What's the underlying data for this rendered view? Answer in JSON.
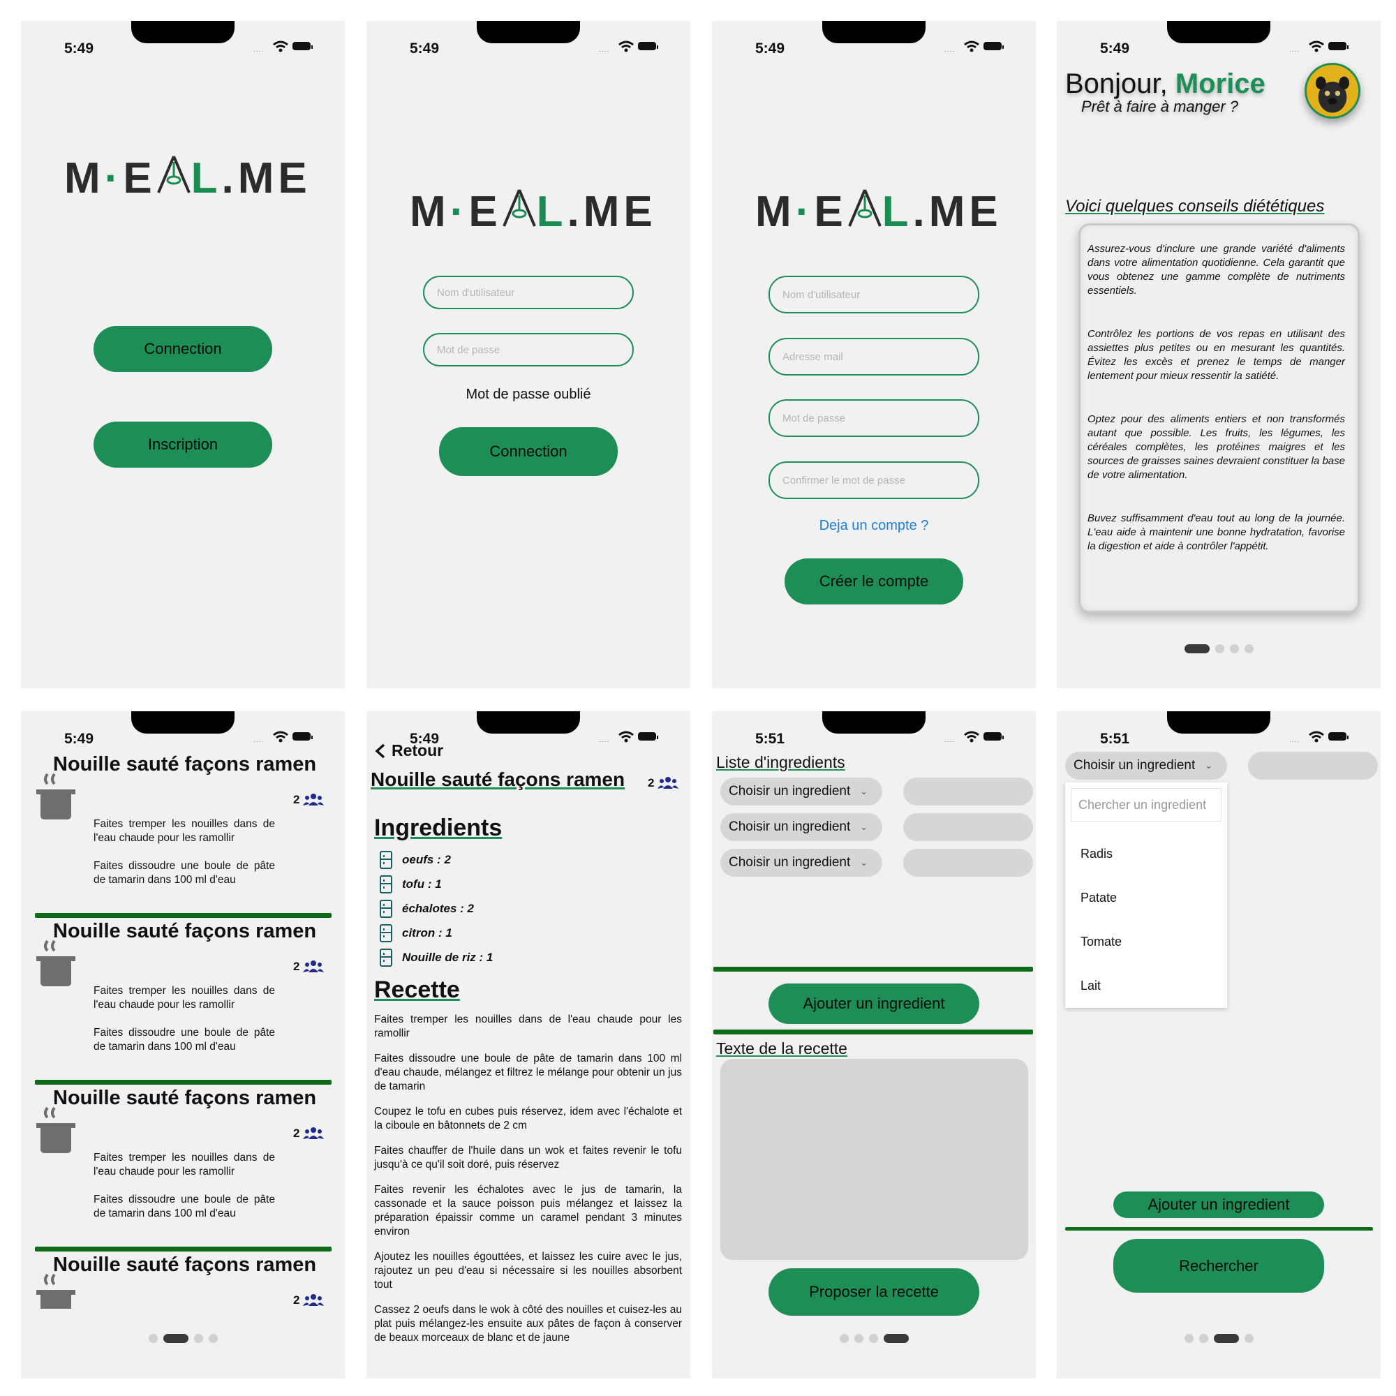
{
  "status": {
    "time_a": "5:49",
    "time_b": "5:51"
  },
  "logo": {
    "part1": "M",
    "part2": "E",
    "part3": "L",
    "part4": ".M",
    "part5": "E"
  },
  "screen1": {
    "connect": "Connection",
    "signup": "Inscription"
  },
  "screen2": {
    "username_ph": "Nom d'utilisateur",
    "password_ph": "Mot de passe",
    "forgot": "Mot de passe oublié",
    "connect": "Connection"
  },
  "screen3": {
    "username_ph": "Nom d'utilisateur",
    "email_ph": "Adresse mail",
    "password_ph": "Mot de passe",
    "confirm_ph": "Confirmer le mot de passe",
    "have_account": "Deja un compte ?",
    "create": "Créer le compte"
  },
  "screen4": {
    "hello": "Bonjour,",
    "name": "Morice",
    "subtitle": "Prêt à faire à manger ?",
    "tips_title": "Voici quelques conseils diététiques",
    "tips": [
      "Assurez-vous d'inclure une grande variété d'aliments dans votre alimentation quotidienne. Cela garantit que vous obtenez une gamme complète de nutriments essentiels.",
      "Contrôlez les portions de vos repas en utilisant des assiettes plus petites ou en mesurant les quantités. Évitez les excès et prenez le temps de manger lentement pour mieux ressentir la satiété.",
      "Optez pour des aliments entiers et non transformés autant que possible. Les fruits, les légumes, les céréales complètes, les protéines maigres et les sources de graisses saines devraient constituer la base de votre alimentation.",
      "Buvez suffisamment d'eau tout au long de la journée. L'eau aide à maintenir une bonne hydratation, favorise la digestion et aide à contrôler l'appétit."
    ]
  },
  "screen5": {
    "cards": [
      {
        "title": "Nouille sauté façons ramen",
        "people": "2",
        "step1": "Faites tremper les nouilles dans de l'eau chaude pour les ramollir",
        "step2": "Faites dissoudre une boule de pâte de tamarin dans 100 ml d'eau"
      },
      {
        "title": "Nouille sauté façons ramen",
        "people": "2",
        "step1": "Faites tremper les nouilles dans de l'eau chaude pour les ramollir",
        "step2": "Faites dissoudre une boule de pâte de tamarin dans 100 ml d'eau"
      },
      {
        "title": "Nouille sauté façons ramen",
        "people": "2",
        "step1": "Faites tremper les nouilles dans de l'eau chaude pour les ramollir",
        "step2": "Faites dissoudre une boule de pâte de tamarin dans 100 ml d'eau"
      },
      {
        "title": "Nouille sauté façons ramen",
        "people": "2"
      }
    ]
  },
  "screen6": {
    "back": "Retour",
    "title": "Nouille sauté façons ramen",
    "people": "2",
    "ingredients_title": "Ingredients",
    "ingredients": [
      "oeufs : 2",
      "tofu : 1",
      "échalotes : 2",
      "citron : 1",
      "Nouille de riz : 1"
    ],
    "recipe_title": "Recette",
    "steps": [
      "Faites tremper les nouilles dans de l'eau chaude pour les ramollir",
      "Faites dissoudre une boule de pâte de tamarin dans 100 ml d'eau chaude, mélangez et filtrez le mélange pour obtenir un jus de tamarin",
      "Coupez le tofu en cubes puis réservez, idem avec l'échalote et la ciboule en bâtonnets de 2 cm",
      "Faites chauffer de l'huile dans un wok et faites revenir le tofu jusqu'à ce qu'il soit doré, puis réservez",
      "Faites revenir les échalotes avec le jus de tamarin, la cassonade et la sauce poisson puis mélangez et laissez la préparation épaissir comme un caramel pendant 3 minutes environ",
      "Ajoutez les nouilles égouttées, et laissez les cuire avec le jus, rajoutez un peu d'eau si nécessaire si les nouilles absorbent tout",
      "Cassez 2 oeufs dans le wok à côté des nouilles et cuisez-les au plat puis mélangez-les ensuite aux pâtes de façon à conserver de beaux morceaux de blanc et de jaune"
    ]
  },
  "screen7": {
    "list_title": "Liste d'ingredients",
    "choose": "Choisir un ingredient",
    "add": "Ajouter un ingredient",
    "text_title": "Texte de la recette",
    "propose": "Proposer la recette"
  },
  "screen8": {
    "choose": "Choisir un ingredient",
    "search_ph": "Chercher un ingredient",
    "options": [
      "Radis",
      "Patate",
      "Tomate",
      "Lait"
    ],
    "add": "Ajouter un ingredient",
    "search": "Rechercher"
  },
  "colors": {
    "green": "#1d8e56",
    "dark_green": "#0f6b17",
    "link_blue": "#1a7fe0",
    "navy": "#1e2a8c"
  }
}
